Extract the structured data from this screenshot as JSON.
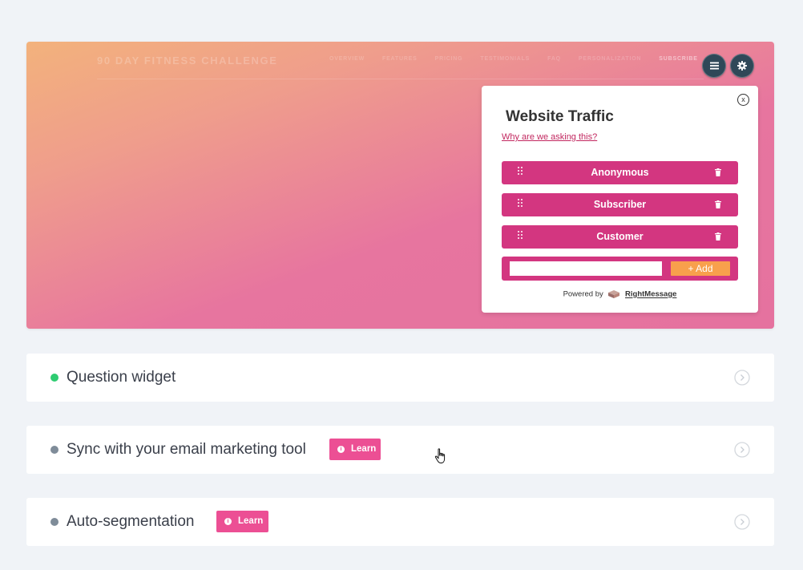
{
  "hero": {
    "brand": "90 DAY FITNESS CHALLENGE",
    "nav": [
      "OVERVIEW",
      "FEATURES",
      "PRICING",
      "TESTIMONIALS",
      "FAQ",
      "PERSONALIZATION",
      "SUBSCRIBE"
    ]
  },
  "popup": {
    "close_label": "x",
    "title": "Website Traffic",
    "why_link": "Why are we asking this?",
    "options": [
      {
        "label": "Anonymous"
      },
      {
        "label": "Subscriber"
      },
      {
        "label": "Customer"
      }
    ],
    "add_input_value": "",
    "add_button": "+ Add",
    "powered_by": "Powered by",
    "powered_brand": "RightMessage"
  },
  "cards": [
    {
      "title": "Question widget",
      "status_color": "#2ecc71"
    },
    {
      "title": "Sync with your email marketing tool",
      "status_color": "#7f8c99",
      "learn_label": "Learn"
    },
    {
      "title": "Auto-segmentation",
      "status_color": "#7f8c99",
      "learn_label": "Learn"
    }
  ],
  "icons": [
    "menu-icon",
    "gear-icon",
    "close-icon",
    "drag-handle-icon",
    "trash-icon",
    "rightmessage-logo-icon",
    "info-icon",
    "chevron-right-icon",
    "hand-cursor-icon"
  ],
  "colors": {
    "option_bg": "#d33680",
    "add_button": "#f8a04c",
    "learn_badge": "#ec4f94",
    "round_button": "#2f4858",
    "link": "#c2275f"
  }
}
